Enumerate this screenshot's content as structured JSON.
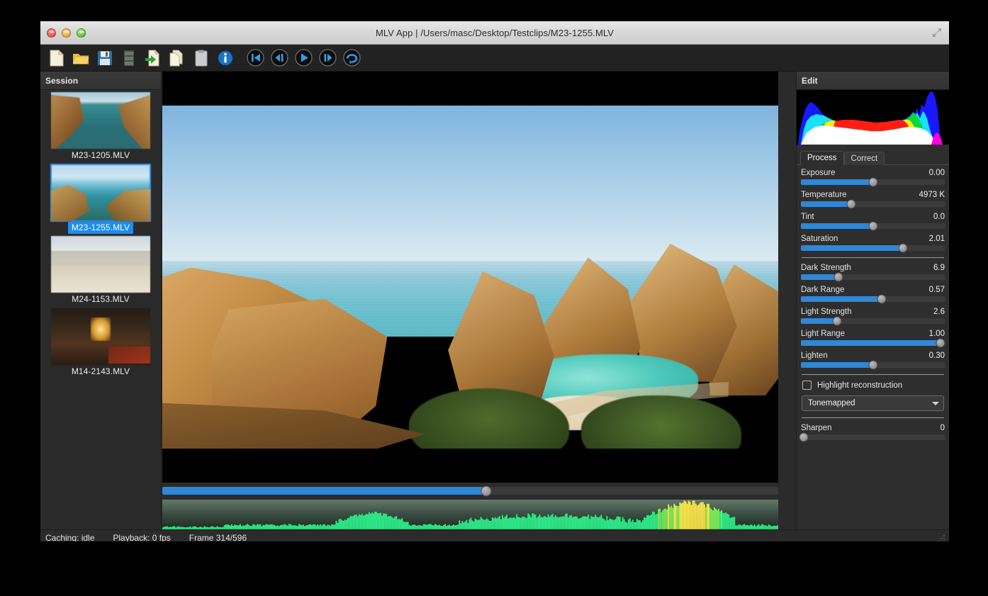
{
  "window": {
    "title": "MLV App | /Users/masc/Desktop/Testclips/M23-1255.MLV",
    "traffic_lights": [
      "close",
      "minimize",
      "zoom"
    ]
  },
  "toolbar": {
    "buttons": [
      {
        "name": "new-file",
        "label": "New"
      },
      {
        "name": "open-folder",
        "label": "Open"
      },
      {
        "name": "save-file",
        "label": "Save"
      },
      {
        "name": "session-list",
        "label": "Session"
      },
      {
        "name": "import-file",
        "label": "Import"
      },
      {
        "name": "copy-file",
        "label": "Copy"
      },
      {
        "name": "paste-clipboard",
        "label": "Paste"
      },
      {
        "name": "info",
        "label": "Info"
      },
      {
        "name": "skip-to-start",
        "label": "Skip to start"
      },
      {
        "name": "step-back",
        "label": "Previous frame"
      },
      {
        "name": "play",
        "label": "Play"
      },
      {
        "name": "step-forward",
        "label": "Next frame"
      },
      {
        "name": "loop",
        "label": "Loop"
      }
    ]
  },
  "sidebar": {
    "header": "Session",
    "clips": [
      {
        "name": "M23-1205.MLV",
        "selected": false,
        "thumb": "t1"
      },
      {
        "name": "M23-1255.MLV",
        "selected": true,
        "thumb": "t2"
      },
      {
        "name": "M24-1153.MLV",
        "selected": false,
        "thumb": "t3"
      },
      {
        "name": "M14-2143.MLV",
        "selected": false,
        "thumb": "t4"
      }
    ]
  },
  "viewer": {
    "timeline": {
      "percent": 52.6
    }
  },
  "edit": {
    "header": "Edit",
    "tabs": [
      {
        "label": "Process",
        "active": true
      },
      {
        "label": "Correct",
        "active": false
      }
    ],
    "sliders": [
      {
        "label": "Exposure",
        "value": "0.00",
        "percent": 50
      },
      {
        "label": "Temperature",
        "value": "4973 K",
        "percent": 35
      },
      {
        "label": "Tint",
        "value": "0.0",
        "percent": 50
      },
      {
        "label": "Saturation",
        "value": "2.01",
        "percent": 71
      },
      {
        "label": "Dark Strength",
        "value": "6.9",
        "percent": 26
      },
      {
        "label": "Dark Range",
        "value": "0.57",
        "percent": 56
      },
      {
        "label": "Light Strength",
        "value": "2.6",
        "percent": 25
      },
      {
        "label": "Light Range",
        "value": "1.00",
        "percent": 97
      },
      {
        "label": "Lighten",
        "value": "0.30",
        "percent": 50
      }
    ],
    "highlight_reconstruction": {
      "label": "Highlight reconstruction",
      "checked": false
    },
    "profile": {
      "value": "Tonemapped"
    },
    "sharpen": {
      "label": "Sharpen",
      "value": "0",
      "percent": 2
    }
  },
  "status": {
    "caching": "Caching: idle",
    "playback": "Playback: 0 fps",
    "frame": "Frame 314/596"
  },
  "colors": {
    "accent": "#2f87d8",
    "selection": "#1d8cf0",
    "panel_bg": "#2e2e2e",
    "window_bg": "#2b2b2b",
    "waveform": "#2ef08a"
  }
}
